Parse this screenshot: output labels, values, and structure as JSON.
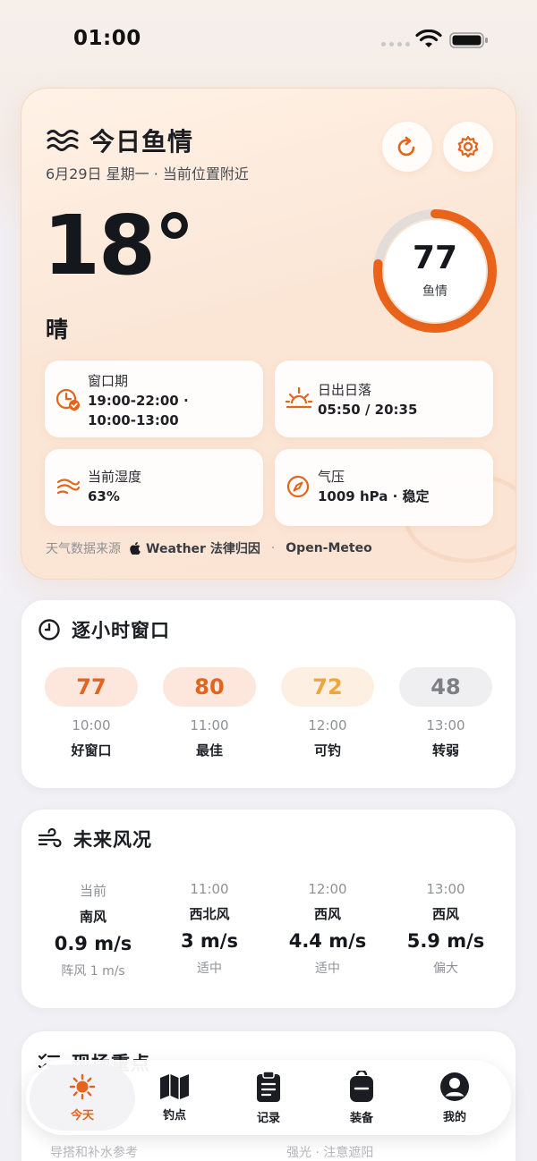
{
  "status_bar": {
    "time": "01:00"
  },
  "hero": {
    "title": "今日鱼情",
    "subtitle": "6月29日 星期一 · 当前位置附近",
    "temperature": "18°",
    "condition": "晴",
    "score": {
      "value": "77",
      "label": "鱼情",
      "fraction": 0.77
    },
    "tiles": {
      "window": {
        "label": "窗口期",
        "line1": "19:00-22:00 ·",
        "line2": "10:00-13:00"
      },
      "sun": {
        "label": "日出日落",
        "value": "05:50 / 20:35"
      },
      "humidity": {
        "label": "当前湿度",
        "value": "63%"
      },
      "pressure": {
        "label": "气压",
        "value": "1009 hPa · 稳定"
      }
    },
    "source": {
      "prefix": "天气数据来源",
      "weather": "Weather 法律归因",
      "sep": "·",
      "meteo": "Open-Meteo"
    }
  },
  "hourly": {
    "title": "逐小时窗口",
    "items": [
      {
        "score": "77",
        "time": "10:00",
        "tag": "好窗口",
        "bg": "#fde6dc",
        "fg": "#e4641b"
      },
      {
        "score": "80",
        "time": "11:00",
        "tag": "最佳",
        "bg": "#fde6dc",
        "fg": "#e4641b"
      },
      {
        "score": "72",
        "time": "12:00",
        "tag": "可钓",
        "bg": "#fdf0e2",
        "fg": "#f0a43a"
      },
      {
        "score": "48",
        "time": "13:00",
        "tag": "转弱",
        "bg": "#efeff1",
        "fg": "#7d7f85"
      }
    ]
  },
  "wind": {
    "title": "未来风况",
    "items": [
      {
        "time": "当前",
        "dir": "南风",
        "speed": "0.9 m/s",
        "note": "阵风 1 m/s"
      },
      {
        "time": "11:00",
        "dir": "西北风",
        "speed": "3 m/s",
        "note": "适中"
      },
      {
        "time": "12:00",
        "dir": "西风",
        "speed": "4.4 m/s",
        "note": "适中"
      },
      {
        "time": "13:00",
        "dir": "西风",
        "speed": "5.9 m/s",
        "note": "偏大"
      }
    ]
  },
  "onsite": {
    "title": "现场重点",
    "left_text": "导搭和补水参考",
    "right_text": "强光 · 注意遮阳"
  },
  "tabbar": {
    "items": [
      {
        "label": "今天"
      },
      {
        "label": "钓点"
      },
      {
        "label": "记录"
      },
      {
        "label": "装备"
      },
      {
        "label": "我的"
      }
    ]
  },
  "colors": {
    "accent": "#e4641b",
    "ring_track": "#e2ddd8"
  }
}
